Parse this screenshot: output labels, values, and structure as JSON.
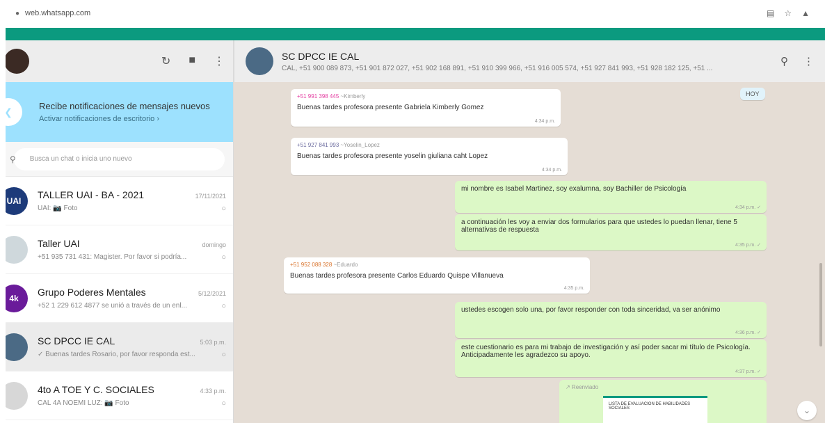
{
  "browser": {
    "url": "web.whatsapp.com",
    "lock_icon": "lock-icon",
    "icons": [
      "reader-icon",
      "star-icon",
      "extension-icon"
    ]
  },
  "colors": {
    "brand_green": "#0b9a7f",
    "notification_bg": "#9de1fe",
    "chat_bg": "#e5ddd5",
    "outgoing_bubble": "#dcf8c6"
  },
  "sidebar": {
    "icons": [
      "status-icon",
      "new-chat-icon",
      "menu-icon"
    ],
    "notification": {
      "title": "Recibe notificaciones de mensajes nuevos",
      "subtitle": "Activar notificaciones de escritorio ›"
    },
    "search_placeholder": "Busca un chat o inicia uno nuevo",
    "chats": [
      {
        "name": "TALLER UAI - BA - 2021",
        "time": "17/11/2021",
        "preview": "UAI: 📷 Foto",
        "avatar_text": "UAI",
        "avatar_color": "#1d3b7a"
      },
      {
        "name": "Taller UAI",
        "time": "domingo",
        "preview": "+51 935 731 431: Magister. Por favor si podría...",
        "avatar_text": "",
        "avatar_color": "#cfd8dc"
      },
      {
        "name": "Grupo Poderes Mentales",
        "time": "5/12/2021",
        "preview": "+52 1 229 612 4877 se unió a través de un enl...",
        "avatar_text": "4k",
        "avatar_color": "#6a1b9a"
      },
      {
        "name": "SC DPCC  IE CAL",
        "time": "5:03 p.m.",
        "preview": "✓ Buenas tardes Rosario, por favor responda est...",
        "avatar_text": "",
        "avatar_color": "#4b6a85"
      },
      {
        "name": "4to A TOE Y C. SOCIALES",
        "time": "4:33 p.m.",
        "preview": "CAL 4A NOEMI LUZ: 📷 Foto",
        "avatar_text": "",
        "avatar_color": "#d7d7d7"
      }
    ]
  },
  "chat": {
    "title": "SC DPCC  IE CAL",
    "members": "CAL, +51 900 089 873, +51 901 872 027, +51 902 168 891, +51 910 399 966, +51 916 005 574, +51 927 841 993, +51 928 182 125, +51 ...",
    "icons": [
      "search-icon",
      "menu-icon"
    ],
    "date_chip": "HOY",
    "messages": [
      {
        "dir": "in",
        "phone": "+51 991 398 445",
        "alias": "~Kimberly",
        "phone_color": "#e542a3",
        "text": "Buenas tardes profesora presente Gabriela Kimberly Gomez",
        "time": "4:34 p.m."
      },
      {
        "dir": "in",
        "phone": "+51 927 841 993",
        "alias": "~Yoselin_Lopez",
        "phone_color": "#6b6b9e",
        "text": "Buenas tardes profesora presente yoselin giuliana caht Lopez",
        "time": "4:34 p.m."
      },
      {
        "dir": "out",
        "text": "mi nombre es Isabel Martinez, soy exalumna, soy Bachiller de Psicología",
        "time": "4:34 p.m. ✓"
      },
      {
        "dir": "out",
        "text": "a continuación les voy a enviar dos formularios para que ustedes lo puedan llenar, tiene 5 alternativas de respuesta",
        "time": "4:35 p.m. ✓"
      },
      {
        "dir": "in",
        "phone": "+51 952 088 328",
        "alias": "~Eduardo",
        "phone_color": "#d9722a",
        "text": "Buenas tardes profesora presente Carlos Eduardo Quispe Villanueva",
        "time": "4:35 p.m."
      },
      {
        "dir": "out",
        "text": "ustedes escogen solo una, por favor responder con toda sinceridad, va ser anónimo",
        "time": "4:36 p.m. ✓"
      },
      {
        "dir": "out",
        "text": "este cuestionario es para mi trabajo de investigación y así poder sacar mi título de Psicología. Anticipadamente les agradezco su apoyo.",
        "time": "4:37 p.m. ✓"
      },
      {
        "dir": "out",
        "forwarded": "↗ Reenviado",
        "doc_title": "LISTA DE EVALUACION DE HABILIDADES SOCIALES"
      }
    ]
  }
}
